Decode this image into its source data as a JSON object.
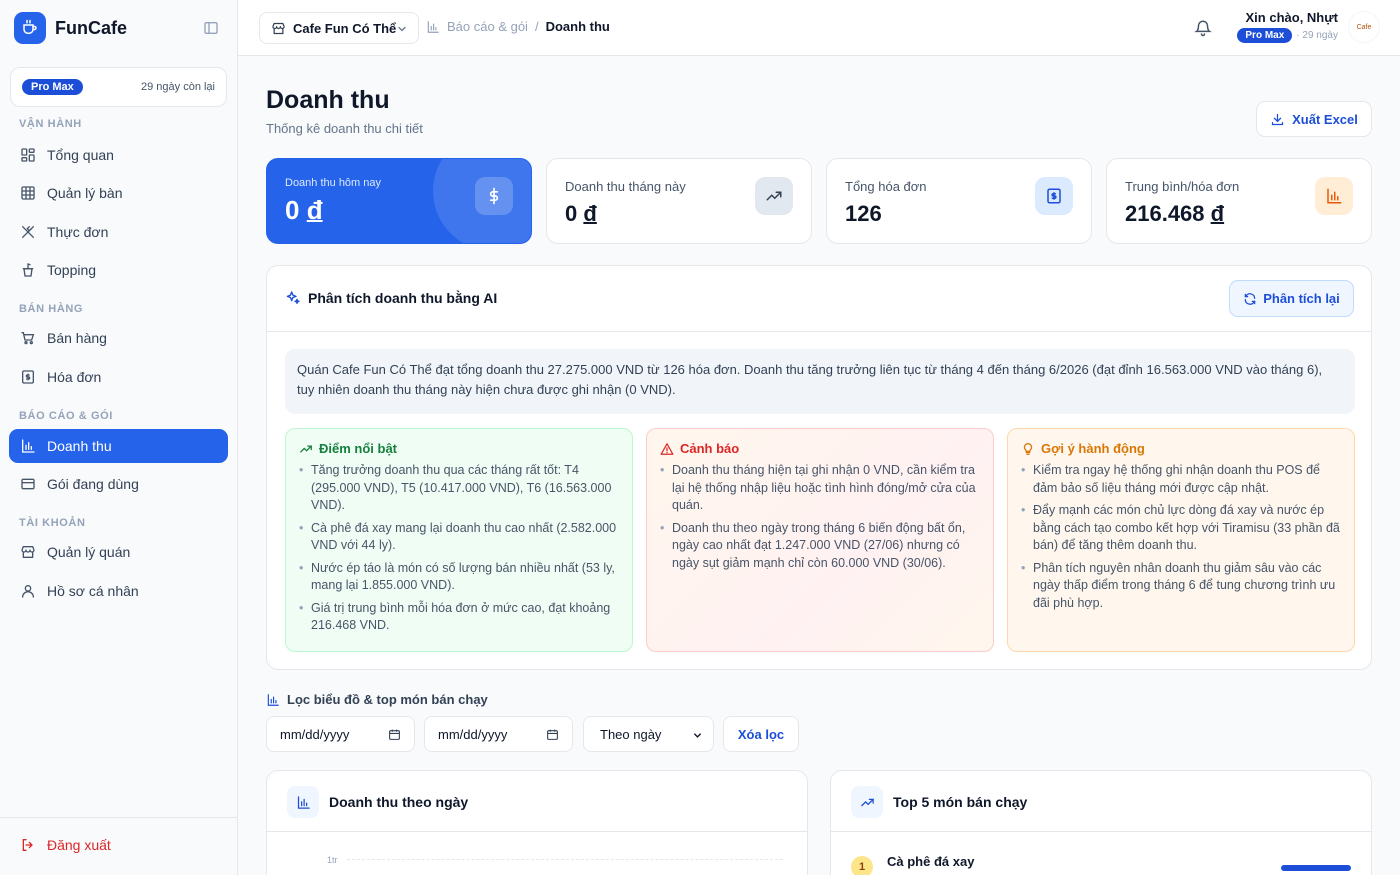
{
  "brand": {
    "name": "FunCafe"
  },
  "sidebar": {
    "plan_badge": "Pro Max",
    "plan_days": "29 ngày còn lại",
    "sections": [
      "VẬN HÀNH",
      "BÁN HÀNG",
      "BÁO CÁO & GÓI",
      "TÀI KHOẢN"
    ],
    "items": [
      {
        "label": "Tổng quan",
        "icon": "dashboard-icon"
      },
      {
        "label": "Quản lý bàn",
        "icon": "table-grid-icon"
      },
      {
        "label": "Thực đơn",
        "icon": "utensils-icon"
      },
      {
        "label": "Topping",
        "icon": "topping-icon"
      },
      {
        "label": "Bán hàng",
        "icon": "cart-icon"
      },
      {
        "label": "Hóa đơn",
        "icon": "receipt-icon"
      },
      {
        "label": "Doanh thu",
        "icon": "bar-chart-icon",
        "active": true
      },
      {
        "label": "Gói đang dùng",
        "icon": "credit-card-icon"
      },
      {
        "label": "Quản lý quán",
        "icon": "store-icon"
      },
      {
        "label": "Hồ sơ cá nhân",
        "icon": "user-icon"
      }
    ],
    "logout": "Đăng xuất"
  },
  "topbar": {
    "store": "Cafe Fun Có Thể",
    "breadcrumb_parent": "Báo cáo & gói",
    "breadcrumb_sep": "/",
    "breadcrumb_current": "Doanh thu",
    "greeting": "Xin chào, Nhựt",
    "plan_badge": "Pro Max",
    "plan_days": "· 29 ngày",
    "avatar_text": "Cafe"
  },
  "page": {
    "title": "Doanh thu",
    "subtitle": "Thống kê doanh thu chi tiết",
    "export_label": "Xuất Excel"
  },
  "stats": [
    {
      "label": "Doanh thu hôm nay",
      "value": "0",
      "unit": "đ"
    },
    {
      "label": "Doanh thu tháng này",
      "value": "0",
      "unit": "đ"
    },
    {
      "label": "Tổng hóa đơn",
      "value": "126",
      "unit": ""
    },
    {
      "label": "Trung bình/hóa đơn",
      "value": "216.468",
      "unit": "đ"
    }
  ],
  "ai": {
    "title": "Phân tích doanh thu bằng AI",
    "reanalyze_label": "Phân tích lại",
    "summary": "Quán Cafe Fun Có Thể đạt tổng doanh thu 27.275.000 VND từ 126 hóa đơn. Doanh thu tăng trưởng liên tục từ tháng 4 đến tháng 6/2026 (đạt đỉnh 16.563.000 VND vào tháng 6), tuy nhiên doanh thu tháng này hiện chưa được ghi nhận (0 VND).",
    "highlights": {
      "title": "Điểm nổi bật",
      "items": [
        "Tăng trưởng doanh thu qua các tháng rất tốt: T4 (295.000 VND), T5 (10.417.000 VND), T6 (16.563.000 VND).",
        "Cà phê đá xay mang lại doanh thu cao nhất (2.582.000 VND với 44 ly).",
        "Nước ép táo là món có số lượng bán nhiều nhất (53 ly, mang lại 1.855.000 VND).",
        "Giá trị trung bình mỗi hóa đơn ở mức cao, đạt khoảng 216.468 VND."
      ]
    },
    "warnings": {
      "title": "Cảnh báo",
      "items": [
        "Doanh thu tháng hiện tại ghi nhận 0 VND, cần kiểm tra lại hệ thống nhập liệu hoặc tình hình đóng/mở cửa của quán.",
        "Doanh thu theo ngày trong tháng 6 biến động bất ổn, ngày cao nhất đạt 1.247.000 VND (27/06) nhưng có ngày sụt giảm mạnh chỉ còn 60.000 VND (30/06)."
      ]
    },
    "actions": {
      "title": "Gợi ý hành động",
      "items": [
        "Kiểm tra ngay hệ thống ghi nhận doanh thu POS để đảm bảo số liệu tháng mới được cập nhật.",
        "Đẩy mạnh các món chủ lực dòng đá xay và nước ép bằng cách tạo combo kết hợp với Tiramisu (33 phần đã bán) để tăng thêm doanh thu.",
        "Phân tích nguyên nhân doanh thu giảm sâu vào các ngày thấp điểm trong tháng 6 để tung chương trình ưu đãi phù hợp."
      ]
    }
  },
  "filters": {
    "title": "Lọc biểu đồ & top món bán chạy",
    "date_from_placeholder": "mm/dd/yyyy",
    "date_to_placeholder": "mm/dd/yyyy",
    "mode": "Theo ngày",
    "clear_label": "Xóa lọc"
  },
  "daily_chart": {
    "title": "Doanh thu theo ngày",
    "y_tick_top": "1tr"
  },
  "top_items": {
    "title": "Top 5 món bán chạy",
    "first": {
      "rank": "1",
      "name": "Cà phê đá xay"
    }
  },
  "colors": {
    "primary": "#2563eb",
    "danger": "#dc2626",
    "success": "#15803d",
    "warning": "#d97706"
  }
}
